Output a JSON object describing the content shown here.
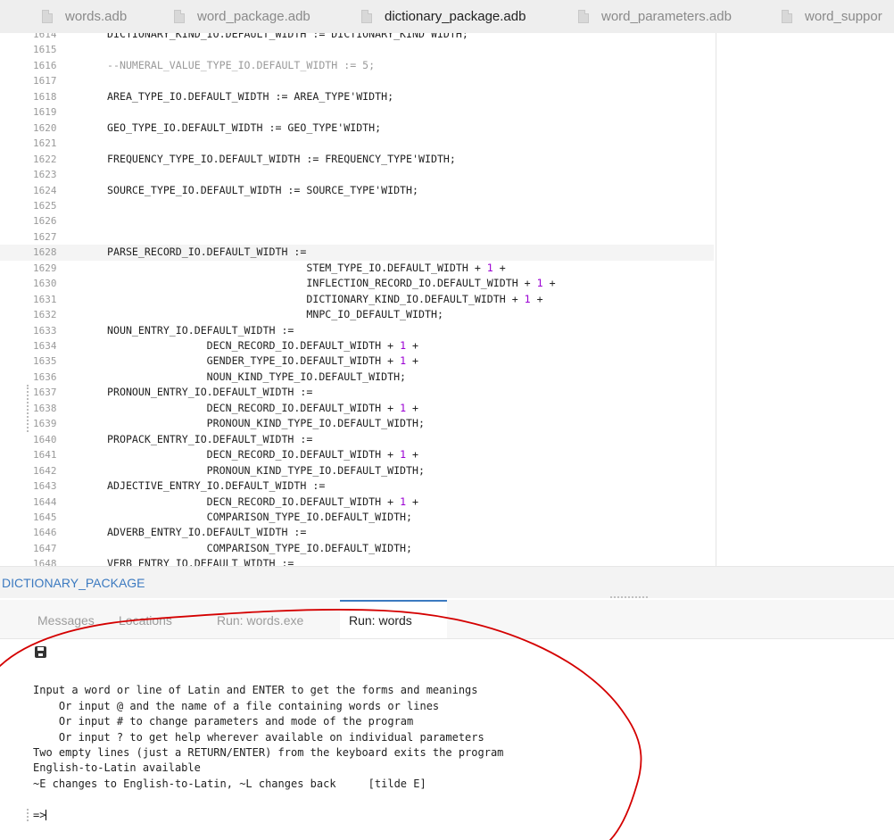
{
  "tabs": [
    {
      "label": "words.adb",
      "active": false
    },
    {
      "label": "word_package.adb",
      "active": false
    },
    {
      "label": "dictionary_package.adb",
      "active": true
    },
    {
      "label": "word_parameters.adb",
      "active": false
    },
    {
      "label": "word_suppor",
      "active": false
    }
  ],
  "editor": {
    "current_line": "1628",
    "lines": [
      {
        "n": "1614",
        "text": "DICTIONARY_KIND_IO.DEFAULT_WIDTH := DICTIONARY_KIND'WIDTH;"
      },
      {
        "n": "1615",
        "text": ""
      },
      {
        "n": "1616",
        "text": "--NUMERAL_VALUE_TYPE_IO.DEFAULT_WIDTH := 5;"
      },
      {
        "n": "1617",
        "text": ""
      },
      {
        "n": "1618",
        "text": "AREA_TYPE_IO.DEFAULT_WIDTH := AREA_TYPE'WIDTH;"
      },
      {
        "n": "1619",
        "text": ""
      },
      {
        "n": "1620",
        "text": "GEO_TYPE_IO.DEFAULT_WIDTH := GEO_TYPE'WIDTH;"
      },
      {
        "n": "1621",
        "text": ""
      },
      {
        "n": "1622",
        "text": "FREQUENCY_TYPE_IO.DEFAULT_WIDTH := FREQUENCY_TYPE'WIDTH;"
      },
      {
        "n": "1623",
        "text": ""
      },
      {
        "n": "1624",
        "text": "SOURCE_TYPE_IO.DEFAULT_WIDTH := SOURCE_TYPE'WIDTH;"
      },
      {
        "n": "1625",
        "text": ""
      },
      {
        "n": "1626",
        "text": ""
      },
      {
        "n": "1627",
        "text": ""
      },
      {
        "n": "1628",
        "text": "PARSE_RECORD_IO.DEFAULT_WIDTH :="
      },
      {
        "n": "1629",
        "text": "                                STEM_TYPE_IO.DEFAULT_WIDTH + 1 +"
      },
      {
        "n": "1630",
        "text": "                                INFLECTION_RECORD_IO.DEFAULT_WIDTH + 1 +"
      },
      {
        "n": "1631",
        "text": "                                DICTIONARY_KIND_IO.DEFAULT_WIDTH + 1 +"
      },
      {
        "n": "1632",
        "text": "                                MNPC_IO_DEFAULT_WIDTH;"
      },
      {
        "n": "1633",
        "text": "NOUN_ENTRY_IO.DEFAULT_WIDTH :="
      },
      {
        "n": "1634",
        "text": "                DECN_RECORD_IO.DEFAULT_WIDTH + 1 +"
      },
      {
        "n": "1635",
        "text": "                GENDER_TYPE_IO.DEFAULT_WIDTH + 1 +"
      },
      {
        "n": "1636",
        "text": "                NOUN_KIND_TYPE_IO.DEFAULT_WIDTH;"
      },
      {
        "n": "1637",
        "text": "PRONOUN_ENTRY_IO.DEFAULT_WIDTH :="
      },
      {
        "n": "1638",
        "text": "                DECN_RECORD_IO.DEFAULT_WIDTH + 1 +"
      },
      {
        "n": "1639",
        "text": "                PRONOUN_KIND_TYPE_IO.DEFAULT_WIDTH;"
      },
      {
        "n": "1640",
        "text": "PROPACK_ENTRY_IO.DEFAULT_WIDTH :="
      },
      {
        "n": "1641",
        "text": "                DECN_RECORD_IO.DEFAULT_WIDTH + 1 +"
      },
      {
        "n": "1642",
        "text": "                PRONOUN_KIND_TYPE_IO.DEFAULT_WIDTH;"
      },
      {
        "n": "1643",
        "text": "ADJECTIVE_ENTRY_IO.DEFAULT_WIDTH :="
      },
      {
        "n": "1644",
        "text": "                DECN_RECORD_IO.DEFAULT_WIDTH + 1 +"
      },
      {
        "n": "1645",
        "text": "                COMPARISON_TYPE_IO.DEFAULT_WIDTH;"
      },
      {
        "n": "1646",
        "text": "ADVERB_ENTRY_IO.DEFAULT_WIDTH :="
      },
      {
        "n": "1647",
        "text": "                COMPARISON_TYPE_IO.DEFAULT_WIDTH;"
      },
      {
        "n": "1648",
        "text": "VERB_ENTRY_IO.DEFAULT_WIDTH :="
      }
    ]
  },
  "package_label": "DICTIONARY_PACKAGE",
  "panel_tabs": [
    {
      "label": "Messages",
      "active": false
    },
    {
      "label": "Locations",
      "active": false
    },
    {
      "label": "Run: words.exe",
      "active": false
    },
    {
      "label": "Run: words",
      "active": true
    }
  ],
  "console": {
    "save_icon": "save-icon",
    "lines": [
      "",
      "Input a word or line of Latin and ENTER to get the forms and meanings",
      "    Or input @ and the name of a file containing words or lines",
      "    Or input # to change parameters and mode of the program",
      "    Or input ? to get help wherever available on individual parameters",
      "Two empty lines (just a RETURN/ENTER) from the keyboard exits the program",
      "English-to-Latin available",
      "~E changes to English-to-Latin, ~L changes back     [tilde E]",
      ""
    ],
    "prompt": "=>"
  },
  "colors": {
    "accent": "#3c7ac0",
    "number_literal": "#9b00d3",
    "comment": "#9a9a9a",
    "annotation": "#d40000"
  }
}
